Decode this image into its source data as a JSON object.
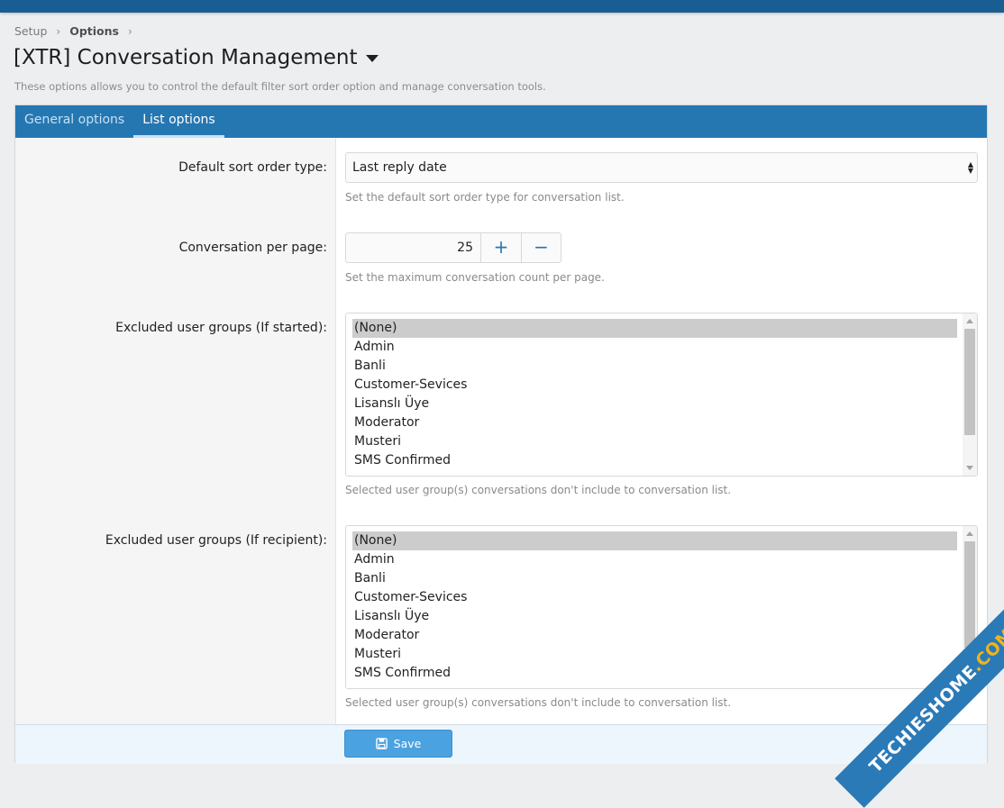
{
  "breadcrumb": {
    "items": [
      "Setup",
      "Options"
    ],
    "separator": "›"
  },
  "header": {
    "title": "[XTR] Conversation Management",
    "description": "These options allows you to control the default filter sort order option and manage conversation tools."
  },
  "tabs": [
    {
      "label": "General options",
      "active": false
    },
    {
      "label": "List options",
      "active": true
    }
  ],
  "form": {
    "sort_order": {
      "label": "Default sort order type:",
      "value": "Last reply date",
      "hint": "Set the default sort order type for conversation list."
    },
    "per_page": {
      "label": "Conversation per page:",
      "value": "25",
      "plus": "+",
      "minus": "−",
      "hint": "Set the maximum conversation count per page."
    },
    "excluded_started": {
      "label": "Excluded user groups (If started):",
      "options": [
        "(None)",
        "Admin",
        "Banli",
        "Customer-Sevices",
        "Lisanslı Üye",
        "Moderator",
        "Musteri",
        "SMS Confirmed"
      ],
      "selected": "(None)",
      "hint": "Selected user group(s) conversations don't include to conversation list."
    },
    "excluded_recipient": {
      "label": "Excluded user groups (If recipient):",
      "options": [
        "(None)",
        "Admin",
        "Banli",
        "Customer-Sevices",
        "Lisanslı Üye",
        "Moderator",
        "Musteri",
        "SMS Confirmed"
      ],
      "selected": "(None)",
      "hint": "Selected user group(s) conversations don't include to conversation list."
    }
  },
  "footer": {
    "save_label": "Save",
    "save_icon": "save-icon"
  },
  "watermark": {
    "part1": "TECHIES",
    "part2": "HOME",
    "part3": ".COM"
  },
  "colors": {
    "topbar": "#1a5d92",
    "tab_bar": "#2577b1",
    "save_button": "#4ba2e0",
    "selected_option": "#cccccc"
  }
}
